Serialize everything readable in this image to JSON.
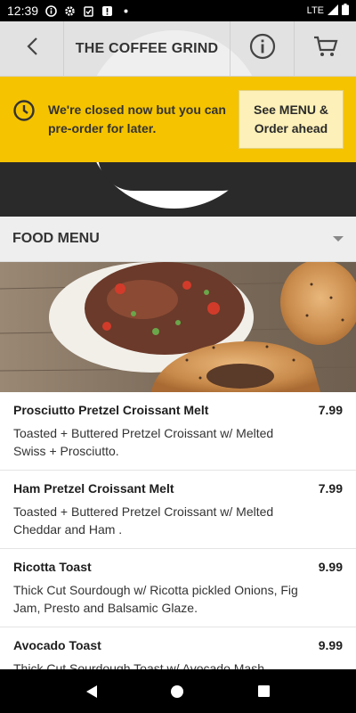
{
  "status_bar": {
    "time": "12:39",
    "icons": [
      "info-circle-icon",
      "gear-icon",
      "clipboard-icon",
      "alert-icon",
      "dot-icon"
    ],
    "network": "LTE",
    "battery_icon": "battery-icon",
    "signal_icon": "signal-icon"
  },
  "app_bar": {
    "title": "THE COFFEE GRIND",
    "back_icon": "chevron-left-icon",
    "info_icon": "info-icon",
    "cart_icon": "cart-icon"
  },
  "banner": {
    "message": "We're closed now but you can pre-order for later.",
    "cta_label": "See MENU & Order ahead",
    "icon": "clock-icon",
    "color": "#f5c300"
  },
  "section": {
    "label": "FOOD MENU"
  },
  "menu_items": [
    {
      "name": "Prosciutto Pretzel Croissant Melt",
      "price": "7.99",
      "description": "Toasted + Buttered Pretzel Croissant w/ Melted Swiss + Prosciutto."
    },
    {
      "name": "Ham Pretzel Croissant Melt",
      "price": "7.99",
      "description": "Toasted + Buttered Pretzel Croissant w/ Melted Cheddar and Ham ."
    },
    {
      "name": "Ricotta Toast",
      "price": "9.99",
      "description": "Thick Cut Sourdough w/ Ricotta pickled Onions, Fig Jam, Presto and Balsamic Glaze."
    },
    {
      "name": "Avocado Toast",
      "price": "9.99",
      "description": "Thick Cut Sourdough Toast w/ Avocado Mash"
    }
  ]
}
